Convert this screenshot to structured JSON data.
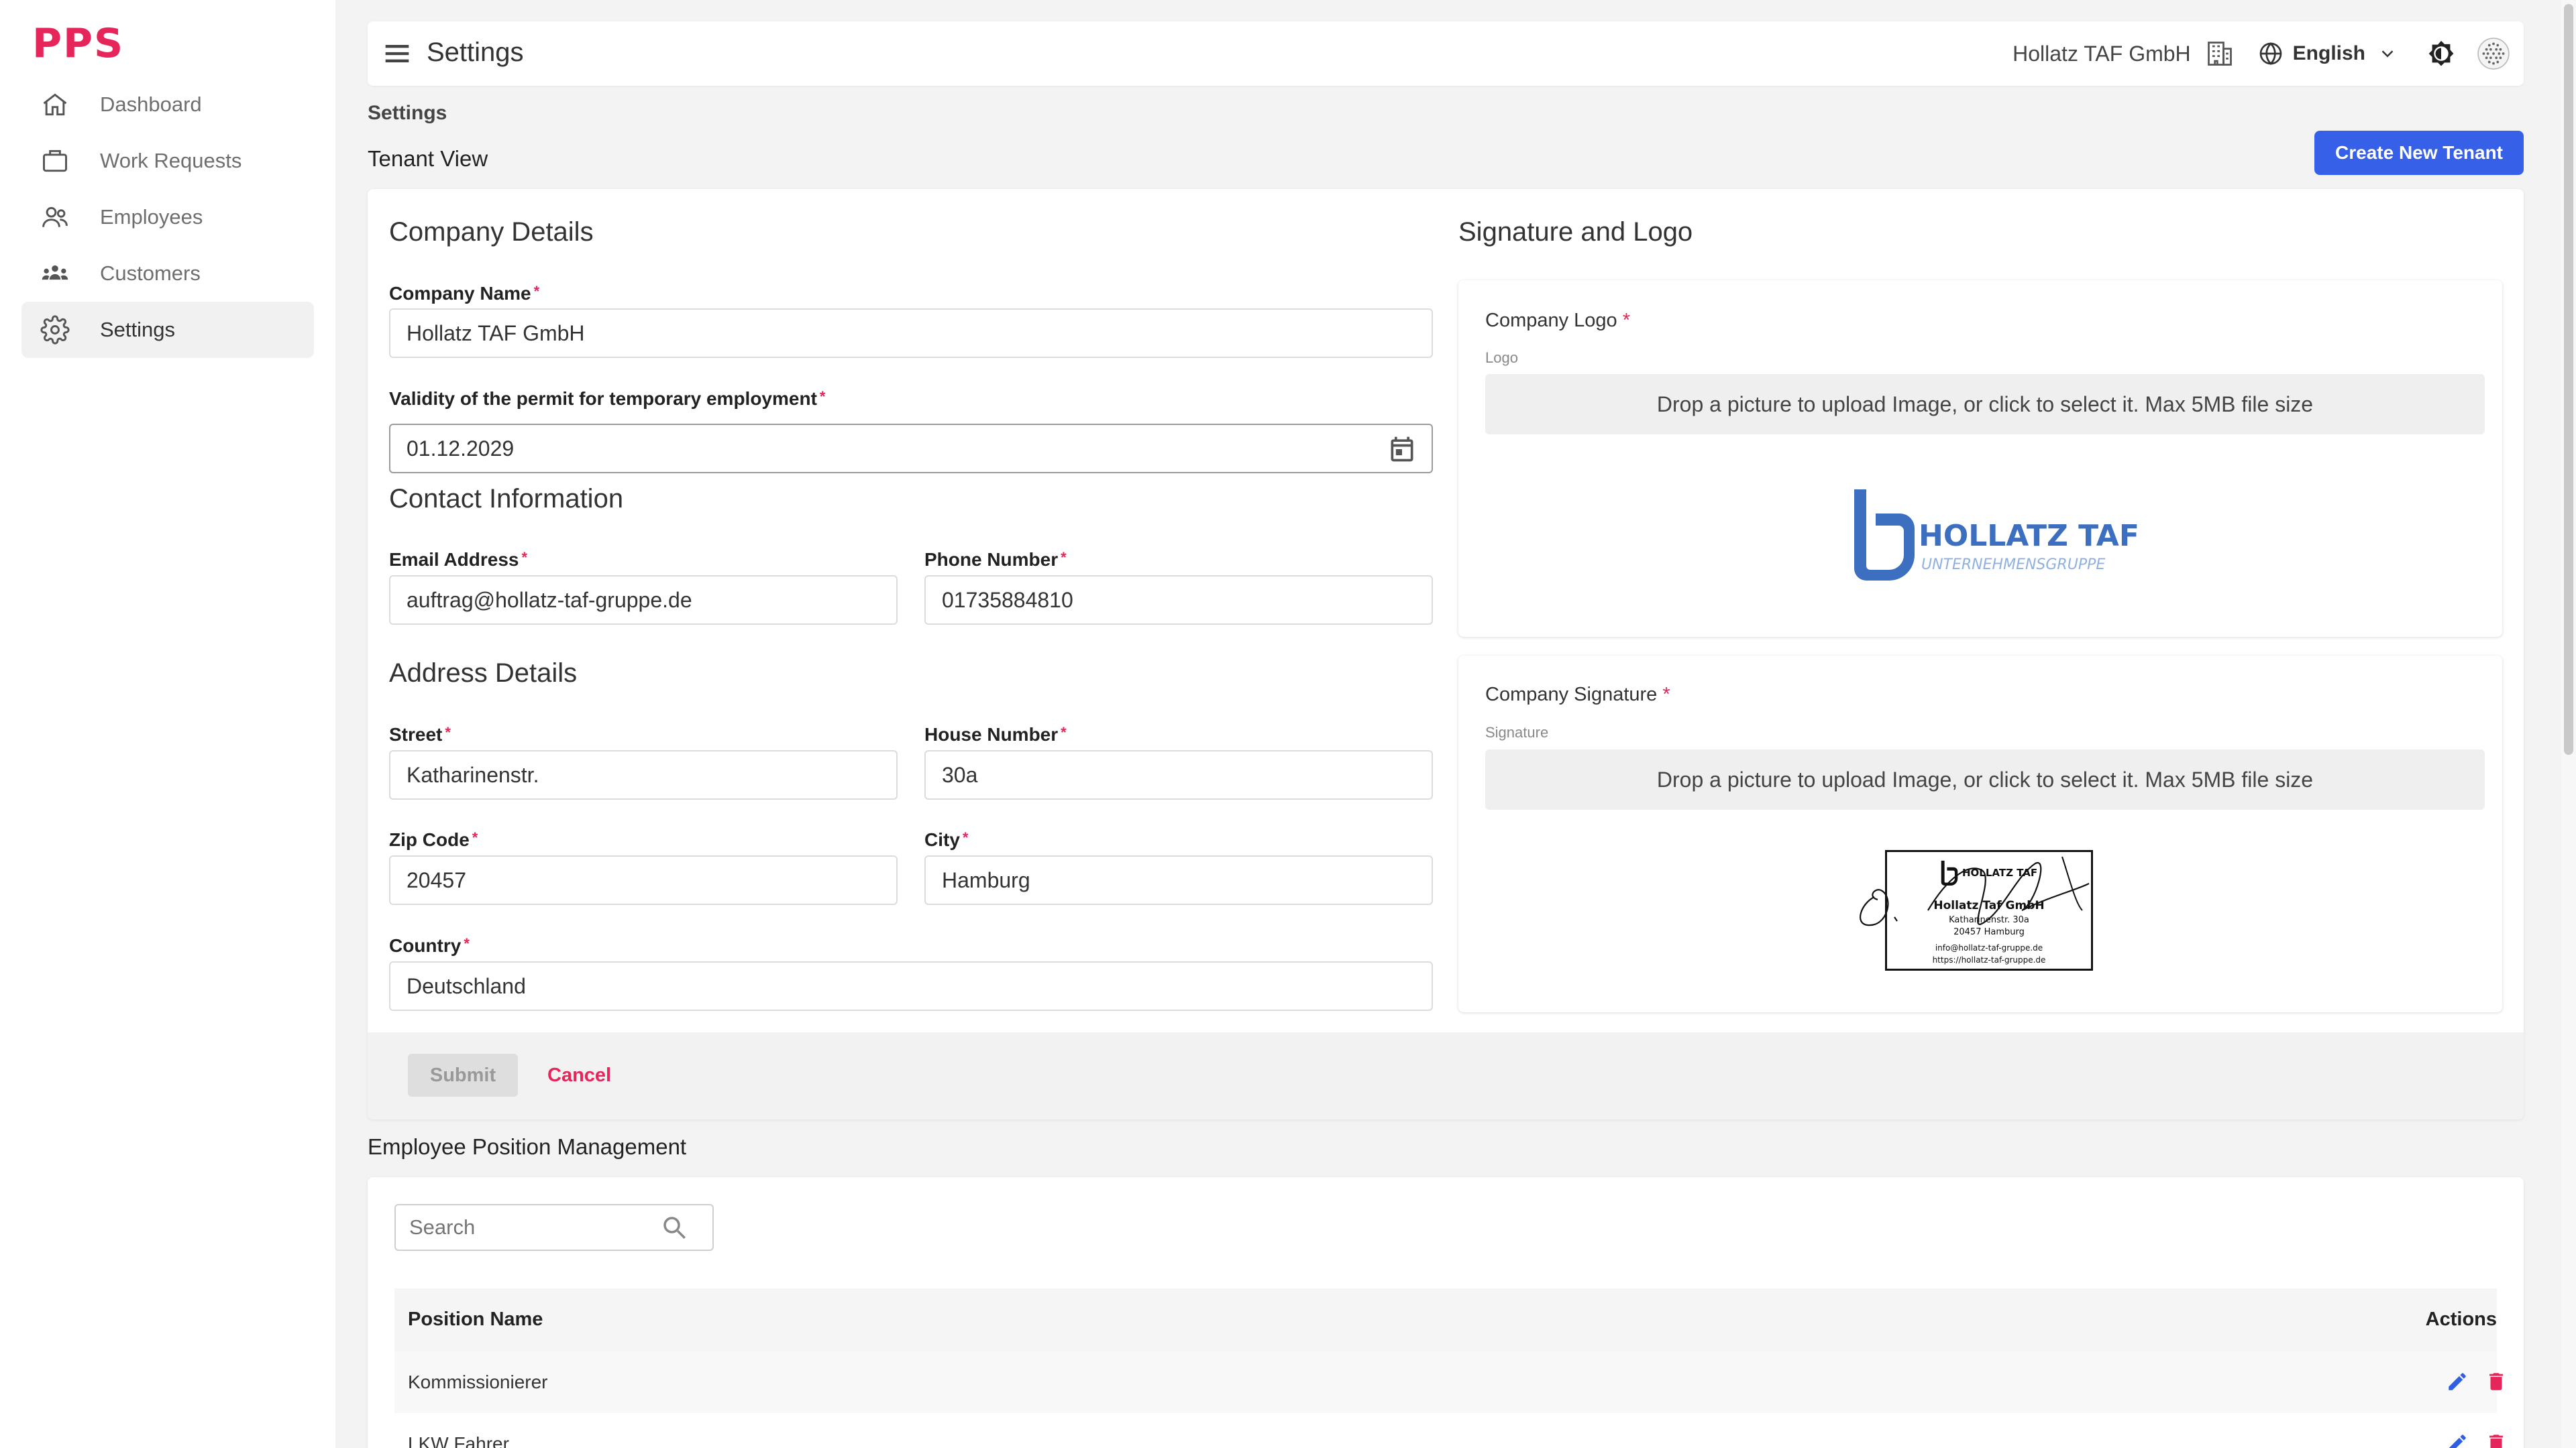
{
  "brand": {
    "logo": "PPS",
    "color": "#e6265a"
  },
  "sidebar": {
    "items": [
      {
        "label": "Dashboard",
        "icon": "home-icon"
      },
      {
        "label": "Work Requests",
        "icon": "briefcase-icon"
      },
      {
        "label": "Employees",
        "icon": "users-icon"
      },
      {
        "label": "Customers",
        "icon": "customers-icon"
      },
      {
        "label": "Settings",
        "icon": "gear-icon",
        "active": true
      }
    ]
  },
  "header": {
    "title": "Settings",
    "tenant_name": "Hollatz TAF GmbH",
    "language": "English"
  },
  "page": {
    "breadcrumb": "Settings",
    "subtitle": "Tenant View",
    "create_button": "Create New Tenant",
    "accent": "#3760e8"
  },
  "form": {
    "company_section": "Company Details",
    "company_name_label": "Company Name",
    "company_name_value": "Hollatz TAF GmbH",
    "permit_label": "Validity of the permit for temporary employment",
    "permit_value": "01.12.2029",
    "contact_section": "Contact Information",
    "email_label": "Email Address",
    "email_value": "auftrag@hollatz-taf-gruppe.de",
    "phone_label": "Phone Number",
    "phone_value": "01735884810",
    "address_section": "Address Details",
    "street_label": "Street",
    "street_value": "Katharinenstr.",
    "house_label": "House Number",
    "house_value": "30a",
    "zip_label": "Zip Code",
    "zip_value": "20457",
    "city_label": "City",
    "city_value": "Hamburg",
    "country_label": "Country",
    "country_value": "Deutschland",
    "required_mark": "*",
    "submit_label": "Submit",
    "cancel_label": "Cancel"
  },
  "signature_logo": {
    "section": "Signature and Logo",
    "logo_label": "Company Logo",
    "logo_sub": "Logo",
    "signature_label": "Company Signature",
    "signature_sub": "Signature",
    "dropzone_text": "Drop a picture to upload Image, or click to select it. Max 5MB file size",
    "logo_title": "HOLLATZ TAF",
    "logo_subtitle": "UNTERNEHMENSGRUPPE",
    "logo_color": "#3d6fc0",
    "stamp_lines": [
      "HOLLATZ TAF",
      "Hollatz Taf GmbH",
      "Katharinenstr. 30a",
      "20457 Hamburg",
      "info@hollatz-taf-gruppe.de",
      "https://hollatz-taf-gruppe.de"
    ]
  },
  "positions": {
    "section": "Employee Position Management",
    "search_placeholder": "Search",
    "col_name": "Position Name",
    "col_actions": "Actions",
    "rows": [
      {
        "name": "Kommissionierer"
      },
      {
        "name": "LKW Fahrer"
      }
    ]
  }
}
